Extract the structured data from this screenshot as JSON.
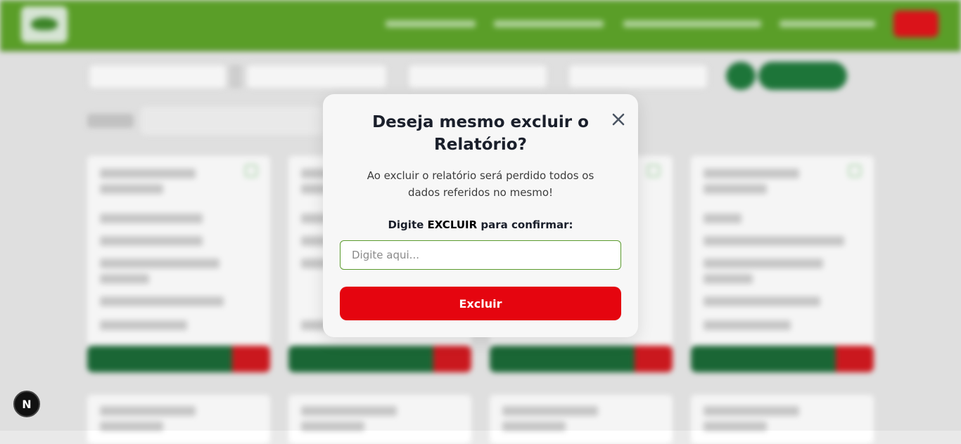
{
  "modal": {
    "title": "Deseja mesmo excluir o Relatório?",
    "description": "Ao excluir o relatório será perdido todos os dados referidos no mesmo!",
    "prompt_prefix": "Digite",
    "prompt_keyword": "EXCLUIR",
    "prompt_suffix": "para confirmar:",
    "input_placeholder": "Digite aqui...",
    "input_value": "",
    "confirm_label": "Excluir",
    "close_icon": "close-icon"
  },
  "devtools": {
    "label": "N"
  },
  "colors": {
    "brand_green": "#5ea52a",
    "danger_red": "#e5050f",
    "dark_green": "#1c6b38",
    "input_border": "#5a9a2c"
  }
}
